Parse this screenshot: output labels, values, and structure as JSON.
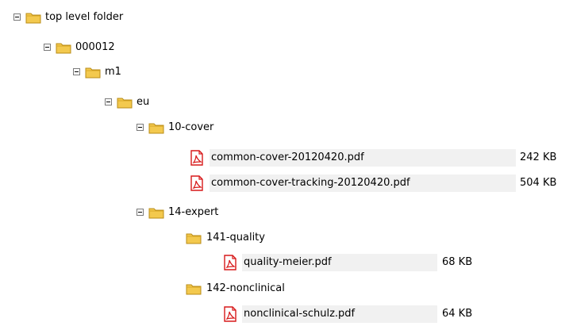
{
  "tree": {
    "nodes": [
      {
        "label": "top level folder",
        "icon": "folder-icon",
        "expanded": true
      },
      {
        "label": "000012",
        "icon": "folder-icon",
        "expanded": true
      },
      {
        "label": "m1",
        "icon": "folder-icon",
        "expanded": true
      },
      {
        "label": "eu",
        "icon": "folder-icon",
        "expanded": true
      },
      {
        "label": "10-cover",
        "icon": "folder-icon",
        "expanded": true
      },
      {
        "label": "common-cover-20120420.pdf",
        "icon": "pdf-file-icon",
        "size": "242 KB"
      },
      {
        "label": "common-cover-tracking-20120420.pdf",
        "icon": "pdf-file-icon",
        "size": "504 KB"
      },
      {
        "label": "14-expert",
        "icon": "folder-icon",
        "expanded": true
      },
      {
        "label": "141-quality",
        "icon": "folder-icon"
      },
      {
        "label": "quality-meier.pdf",
        "icon": "pdf-file-icon",
        "size": "68 KB"
      },
      {
        "label": "142-nonclinical",
        "icon": "folder-icon"
      },
      {
        "label": "nonclinical-schulz.pdf",
        "icon": "pdf-file-icon",
        "size": "64 KB"
      }
    ]
  },
  "colors": {
    "folder_fill": "#f3c94e",
    "folder_stroke": "#b98c17",
    "pdf_red": "#d7191a",
    "row_highlight": "#f1f1f1",
    "toggle_border": "#7a7a7a"
  }
}
